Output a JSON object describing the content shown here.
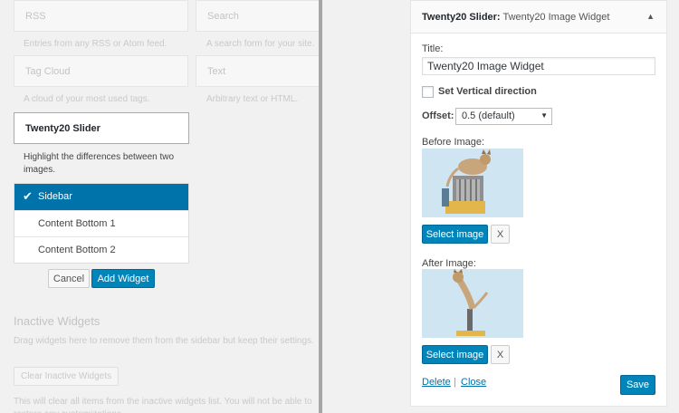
{
  "available_widgets": [
    {
      "title": "RSS",
      "description": "Entries from any RSS or Atom feed."
    },
    {
      "title": "Search",
      "description": "A search form for your site."
    },
    {
      "title": "Tag Cloud",
      "description": "A cloud of your most used tags."
    },
    {
      "title": "Text",
      "description": "Arbitrary text or HTML."
    }
  ],
  "active_widget": {
    "title": "Twenty20 Slider",
    "description": "Highlight the differences between two images."
  },
  "sidebar_choices": [
    {
      "label": "Sidebar",
      "selected": true
    },
    {
      "label": "Content Bottom 1",
      "selected": false
    },
    {
      "label": "Content Bottom 2",
      "selected": false
    }
  ],
  "actions": {
    "cancel": "Cancel",
    "add": "Add Widget"
  },
  "inactive": {
    "title": "Inactive Widgets",
    "description": "Drag widgets here to remove them from the sidebar but keep their settings.",
    "clear_button": "Clear Inactive Widgets",
    "clear_description": "This will clear all items from the inactive widgets list. You will not be able to restore any customizations."
  },
  "widget_form": {
    "header_bold": "Twenty20 Slider:",
    "header_sub": "Twenty20 Image Widget",
    "title_label": "Title:",
    "title_value": "Twenty20 Image Widget",
    "vertical_label": "Set Vertical direction",
    "vertical_checked": false,
    "offset_label": "Offset:",
    "offset_value": "0.5 (default)",
    "before_label": "Before Image:",
    "after_label": "After Image:",
    "select_image": "Select image",
    "remove": "X",
    "delete": "Delete",
    "separator": "|",
    "close": "Close",
    "save": "Save"
  },
  "colors": {
    "accent": "#0085ba",
    "selected": "#0073aa",
    "link": "#0073aa"
  }
}
